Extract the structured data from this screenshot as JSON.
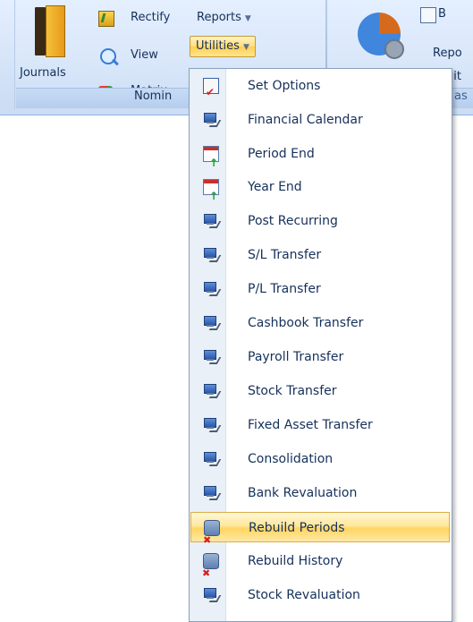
{
  "ribbon": {
    "journals_label": "Journals",
    "rectify_label": "Rectify",
    "view_label": "View",
    "matrix_label": "Matrix",
    "reports_label": "Reports",
    "utilities_label": "Utilities",
    "group_label": "Nomin",
    "right_top_label": "B",
    "right_mid_label": "Repo",
    "right_bottom_label": "ilit",
    "right_group_label": "as",
    "dropdown_arrow": "▼"
  },
  "menu": {
    "items": [
      {
        "label": "Set Options",
        "icon": "options-icon"
      },
      {
        "label": "Financial Calendar",
        "icon": "computer-icon"
      },
      {
        "label": "Period End",
        "icon": "calendar-icon"
      },
      {
        "label": "Year End",
        "icon": "calendar-icon"
      },
      {
        "label": "Post Recurring",
        "icon": "computer-icon"
      },
      {
        "label": "S/L Transfer",
        "icon": "computer-icon"
      },
      {
        "label": "P/L Transfer",
        "icon": "computer-icon"
      },
      {
        "label": "Cashbook Transfer",
        "icon": "computer-icon"
      },
      {
        "label": "Payroll Transfer",
        "icon": "computer-icon"
      },
      {
        "label": "Stock Transfer",
        "icon": "computer-icon"
      },
      {
        "label": "Fixed Asset Transfer",
        "icon": "computer-icon"
      },
      {
        "label": "Consolidation",
        "icon": "computer-icon"
      },
      {
        "label": "Bank Revaluation",
        "icon": "computer-icon"
      },
      {
        "label": "Rebuild Periods",
        "icon": "database-icon"
      },
      {
        "label": "Rebuild History",
        "icon": "database-icon"
      },
      {
        "label": "Stock Revaluation",
        "icon": "computer-icon"
      }
    ],
    "selected_index": 13
  }
}
